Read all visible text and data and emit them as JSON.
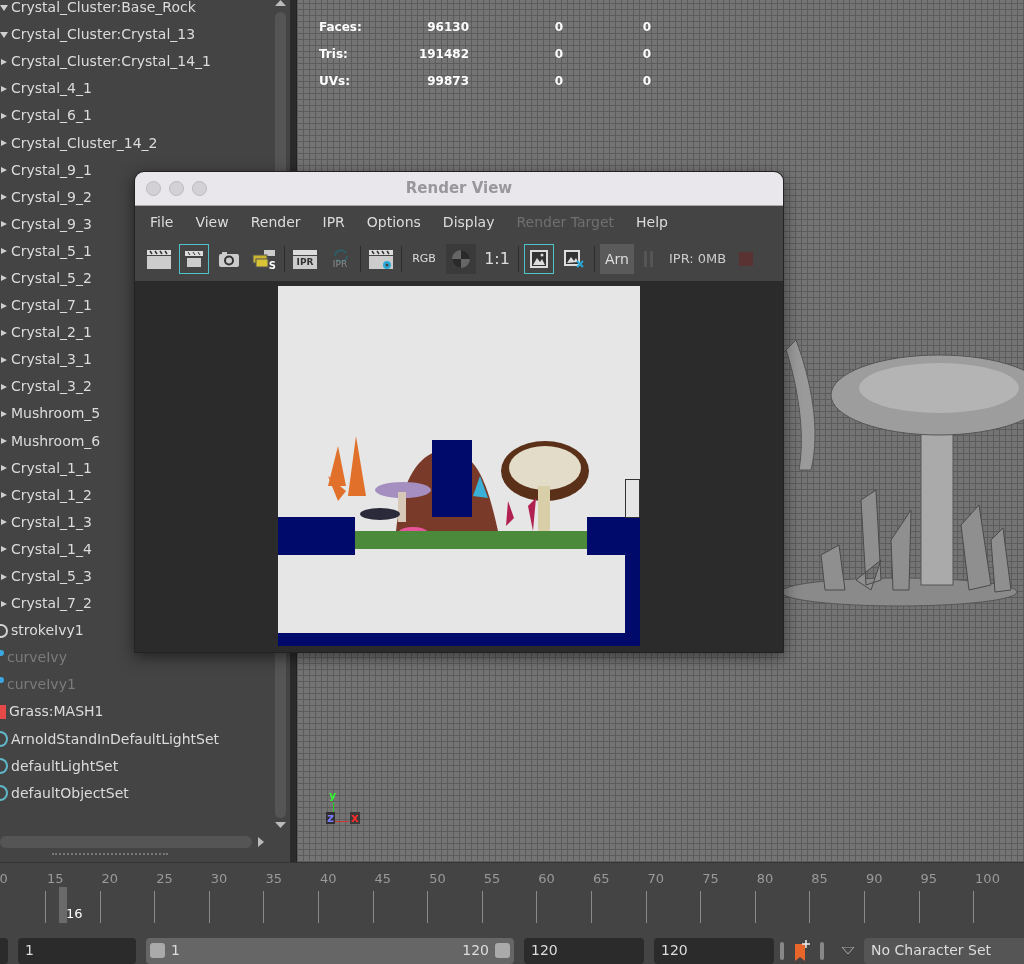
{
  "outliner": {
    "items": [
      {
        "kind": "group",
        "name": "Crystal_Cluster:Base_Rock",
        "expanded": true,
        "dimmed": false
      },
      {
        "kind": "group",
        "name": "Crystal_Cluster:Crystal_13",
        "expanded": true,
        "dimmed": false
      },
      {
        "kind": "group",
        "name": "Crystal_Cluster:Crystal_14_1",
        "expanded": false,
        "dimmed": false
      },
      {
        "kind": "group",
        "name": "Crystal_4_1",
        "expanded": false,
        "dimmed": false
      },
      {
        "kind": "group",
        "name": "Crystal_6_1",
        "expanded": false,
        "dimmed": false
      },
      {
        "kind": "group",
        "name": "Crystal_Cluster_14_2",
        "expanded": false,
        "dimmed": false
      },
      {
        "kind": "group",
        "name": "Crystal_9_1",
        "expanded": false,
        "dimmed": false
      },
      {
        "kind": "group",
        "name": "Crystal_9_2",
        "expanded": false,
        "dimmed": false
      },
      {
        "kind": "group",
        "name": "Crystal_9_3",
        "expanded": false,
        "dimmed": false
      },
      {
        "kind": "group",
        "name": "Crystal_5_1",
        "expanded": false,
        "dimmed": false
      },
      {
        "kind": "group",
        "name": "Crystal_5_2",
        "expanded": false,
        "dimmed": false
      },
      {
        "kind": "group",
        "name": "Crystal_7_1",
        "expanded": false,
        "dimmed": false
      },
      {
        "kind": "group",
        "name": "Crystal_2_1",
        "expanded": false,
        "dimmed": false
      },
      {
        "kind": "group",
        "name": "Crystal_3_1",
        "expanded": false,
        "dimmed": false
      },
      {
        "kind": "group",
        "name": "Crystal_3_2",
        "expanded": false,
        "dimmed": false
      },
      {
        "kind": "group",
        "name": "Mushroom_5",
        "expanded": false,
        "dimmed": false
      },
      {
        "kind": "group",
        "name": "Mushroom_6",
        "expanded": false,
        "dimmed": false
      },
      {
        "kind": "group",
        "name": "Crystal_1_1",
        "expanded": false,
        "dimmed": false
      },
      {
        "kind": "group",
        "name": "Crystal_1_2",
        "expanded": false,
        "dimmed": false
      },
      {
        "kind": "group",
        "name": "Crystal_1_3",
        "expanded": false,
        "dimmed": false
      },
      {
        "kind": "group",
        "name": "Crystal_1_4",
        "expanded": false,
        "dimmed": false
      },
      {
        "kind": "group",
        "name": "Crystal_5_3",
        "expanded": false,
        "dimmed": false
      },
      {
        "kind": "group",
        "name": "Crystal_7_2",
        "expanded": false,
        "dimmed": false
      },
      {
        "kind": "stroke",
        "name": "strokeIvy1",
        "dimmed": false
      },
      {
        "kind": "curve",
        "name": "curveIvy",
        "dimmed": true
      },
      {
        "kind": "curve",
        "name": "curveIvy1",
        "dimmed": true
      },
      {
        "kind": "mash",
        "name": "Grass:MASH1",
        "dimmed": false
      },
      {
        "kind": "set",
        "name": "ArnoldStandInDefaultLightSet",
        "dimmed": false
      },
      {
        "kind": "set",
        "name": "defaultLightSet",
        "dimmed": false
      },
      {
        "kind": "set",
        "name": "defaultObjectSet",
        "dimmed": false
      }
    ]
  },
  "viewport": {
    "stats": [
      {
        "label": "Faces:",
        "value": "96130",
        "column_3": "0",
        "column_4": "0"
      },
      {
        "label": "Tris:",
        "value": "191482",
        "column_3": "0",
        "column_4": "0"
      },
      {
        "label": "UVs:",
        "value": "99873",
        "column_3": "0",
        "column_4": "0"
      }
    ],
    "axes": {
      "y": "y",
      "z": "z",
      "x": "x"
    }
  },
  "render_view": {
    "title": "Render View",
    "menu": [
      {
        "label": "File",
        "disabled": false
      },
      {
        "label": "View",
        "disabled": false
      },
      {
        "label": "Render",
        "disabled": false
      },
      {
        "label": "IPR",
        "disabled": false
      },
      {
        "label": "Options",
        "disabled": false
      },
      {
        "label": "Display",
        "disabled": false
      },
      {
        "label": "Render Target",
        "disabled": true
      },
      {
        "label": "Help",
        "disabled": false
      }
    ],
    "toolbar": [
      {
        "kind": "clapper",
        "selected": false
      },
      {
        "kind": "region",
        "selected": true
      },
      {
        "kind": "snapshot",
        "selected": false
      },
      {
        "kind": "batch",
        "selected": false,
        "label": "S"
      },
      {
        "kind": "ipr",
        "selected": false,
        "label": "IPR"
      },
      {
        "kind": "ipr-refresh",
        "selected": false,
        "label": "IPR"
      },
      {
        "kind": "settings",
        "selected": false
      },
      {
        "kind": "channel",
        "selected": false,
        "label": "RGB"
      },
      {
        "kind": "checker",
        "selected": false
      },
      {
        "kind": "ratio",
        "selected": false,
        "label": "1:1"
      },
      {
        "kind": "keep-image",
        "selected": true
      },
      {
        "kind": "remove-image",
        "selected": false
      },
      {
        "kind": "renderer",
        "selected": false,
        "label": "Arn"
      },
      {
        "kind": "pause",
        "selected": false
      },
      {
        "kind": "memory",
        "selected": false,
        "label": "IPR: 0MB"
      },
      {
        "kind": "stop",
        "selected": false
      }
    ]
  },
  "timeline": {
    "ticks": [
      "0",
      "15",
      "20",
      "25",
      "30",
      "35",
      "40",
      "45",
      "50",
      "55",
      "60",
      "65",
      "70",
      "75",
      "80",
      "85",
      "90",
      "95",
      "100"
    ],
    "current_frame": "16",
    "level": 0.058
  },
  "range_bar": {
    "level": 1,
    "start_time": "1",
    "range_start": "1",
    "range_end": "120",
    "end_time": "120",
    "playback_end": "120",
    "character_set": "No Character Set"
  }
}
